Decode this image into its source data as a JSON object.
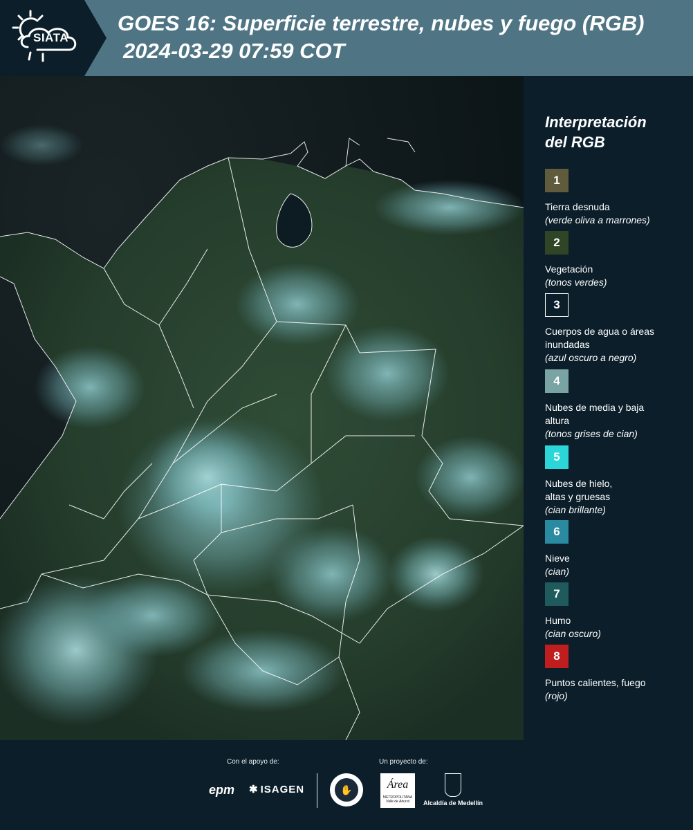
{
  "header": {
    "logo_text": "SIATA",
    "title": "GOES 16: Superficie terrestre, nubes y fuego (RGB)",
    "datetime": "2024-03-29 07:59 COT"
  },
  "legend": {
    "title_line1": "Interpretación",
    "title_line2": "del RGB",
    "items": [
      {
        "num": "1",
        "color": "#5f5b3c",
        "label": "Tierra desnuda",
        "note": "(verde oliva a marrones)"
      },
      {
        "num": "2",
        "color": "#2f4525",
        "label": "Vegetación",
        "note": "(tonos verdes)"
      },
      {
        "num": "3",
        "color": "#0b1e2a",
        "label": "Cuerpos de agua o áreas inundadas",
        "note": "(azul oscuro a negro)"
      },
      {
        "num": "4",
        "color": "#7aa3a3",
        "label": "Nubes de media y baja altura",
        "note": "(tonos grises de cian)"
      },
      {
        "num": "5",
        "color": "#2ad6d8",
        "label": "Nubes de hielo, altas y gruesas",
        "note": "(cian brillante)"
      },
      {
        "num": "6",
        "color": "#2a8aa0",
        "label": "Nieve",
        "note": "(cian)"
      },
      {
        "num": "7",
        "color": "#1f5a5c",
        "label": "Humo",
        "note": "(cian oscuro)"
      },
      {
        "num": "8",
        "color": "#c01e1e",
        "label": "Puntos calientes, fuego",
        "note": "(rojo)"
      }
    ]
  },
  "footer": {
    "support_caption": "Con el apoyo de:",
    "project_caption": "Un proyecto de:",
    "epm": "epm",
    "isagen": "ISAGEN",
    "area_metro": "Área",
    "area_metro_sub": "METROPOLITANA",
    "area_metro_sub2": "Valle de Aburrá",
    "alcaldia": "Alcaldía de Medellín"
  }
}
